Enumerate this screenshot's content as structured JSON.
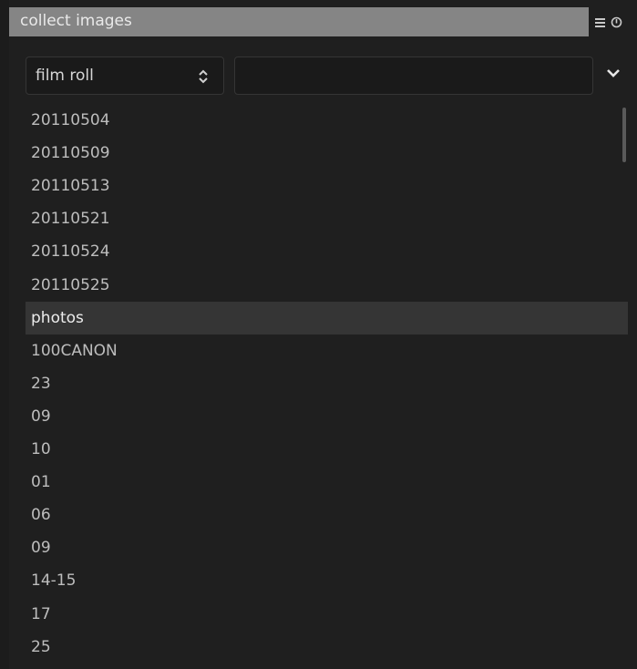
{
  "header": {
    "title": "collect images",
    "icons": [
      "menu-icon",
      "power-icon"
    ]
  },
  "filter": {
    "property_label": "film roll",
    "search_value": "",
    "expand_icon": "chevron-down-icon"
  },
  "list": {
    "selected_index": 6,
    "items": [
      "20110504",
      "20110509",
      "20110513",
      "20110521",
      "20110524",
      "20110525",
      "photos",
      "100CANON",
      "23",
      "09",
      "10",
      "01",
      "06",
      "09",
      "14-15",
      "17",
      "25"
    ]
  },
  "colors": {
    "background": "#1f1f1f",
    "header": "#858585",
    "selected_row": "#353535",
    "text": "#bdbdbd",
    "text_selected": "#ececec"
  }
}
